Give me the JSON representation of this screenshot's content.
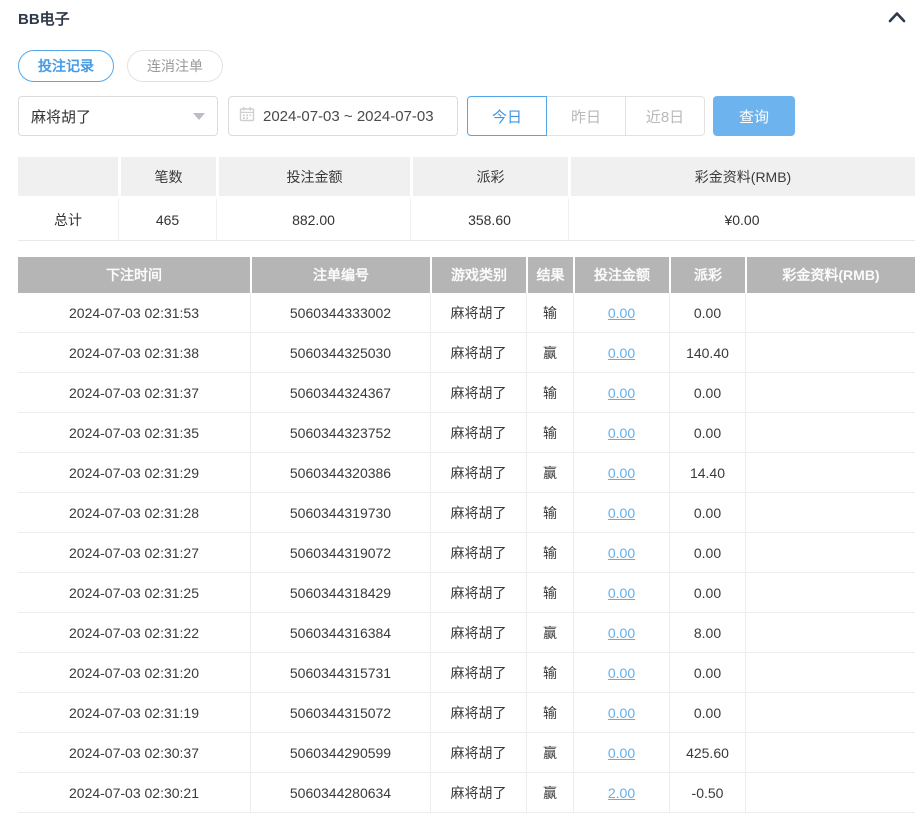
{
  "panel": {
    "title": "BB电子",
    "collapse_icon": "chevron-up-icon"
  },
  "tabs": [
    {
      "name": "tab-bet-records",
      "label": "投注记录",
      "active": true
    },
    {
      "name": "tab-cancelled-orders",
      "label": "连消注单",
      "active": false
    }
  ],
  "filters": {
    "game_select": {
      "value": "麻将胡了"
    },
    "date_range": {
      "value": "2024-07-03 ~ 2024-07-03"
    },
    "quick_buttons": [
      {
        "name": "today-button",
        "label": "今日",
        "active": true
      },
      {
        "name": "yesterday-button",
        "label": "昨日",
        "active": false
      },
      {
        "name": "last-8-days-button",
        "label": "近8日",
        "active": false
      }
    ],
    "search_label": "查询"
  },
  "summary": {
    "headers": [
      "",
      "笔数",
      "投注金额",
      "派彩",
      "彩金资料(RMB)"
    ],
    "row_label": "总计",
    "count": "465",
    "bet_amount": "882.00",
    "payout": "358.60",
    "bonus": "¥0.00"
  },
  "records_table": {
    "headers": [
      "下注时间",
      "注单编号",
      "游戏类别",
      "结果",
      "投注金额",
      "派彩",
      "彩金资料(RMB)"
    ],
    "rows": [
      {
        "time": "2024-07-03 02:31:53",
        "order_id": "5060344333002",
        "game": "麻将胡了",
        "result": "输",
        "bet": "0.00",
        "payout": "0.00",
        "bonus": ""
      },
      {
        "time": "2024-07-03 02:31:38",
        "order_id": "5060344325030",
        "game": "麻将胡了",
        "result": "赢",
        "bet": "0.00",
        "payout": "140.40",
        "bonus": ""
      },
      {
        "time": "2024-07-03 02:31:37",
        "order_id": "5060344324367",
        "game": "麻将胡了",
        "result": "输",
        "bet": "0.00",
        "payout": "0.00",
        "bonus": ""
      },
      {
        "time": "2024-07-03 02:31:35",
        "order_id": "5060344323752",
        "game": "麻将胡了",
        "result": "输",
        "bet": "0.00",
        "payout": "0.00",
        "bonus": ""
      },
      {
        "time": "2024-07-03 02:31:29",
        "order_id": "5060344320386",
        "game": "麻将胡了",
        "result": "赢",
        "bet": "0.00",
        "payout": "14.40",
        "bonus": ""
      },
      {
        "time": "2024-07-03 02:31:28",
        "order_id": "5060344319730",
        "game": "麻将胡了",
        "result": "输",
        "bet": "0.00",
        "payout": "0.00",
        "bonus": ""
      },
      {
        "time": "2024-07-03 02:31:27",
        "order_id": "5060344319072",
        "game": "麻将胡了",
        "result": "输",
        "bet": "0.00",
        "payout": "0.00",
        "bonus": ""
      },
      {
        "time": "2024-07-03 02:31:25",
        "order_id": "5060344318429",
        "game": "麻将胡了",
        "result": "输",
        "bet": "0.00",
        "payout": "0.00",
        "bonus": ""
      },
      {
        "time": "2024-07-03 02:31:22",
        "order_id": "5060344316384",
        "game": "麻将胡了",
        "result": "赢",
        "bet": "0.00",
        "payout": "8.00",
        "bonus": ""
      },
      {
        "time": "2024-07-03 02:31:20",
        "order_id": "5060344315731",
        "game": "麻将胡了",
        "result": "输",
        "bet": "0.00",
        "payout": "0.00",
        "bonus": ""
      },
      {
        "time": "2024-07-03 02:31:19",
        "order_id": "5060344315072",
        "game": "麻将胡了",
        "result": "输",
        "bet": "0.00",
        "payout": "0.00",
        "bonus": ""
      },
      {
        "time": "2024-07-03 02:30:37",
        "order_id": "5060344290599",
        "game": "麻将胡了",
        "result": "赢",
        "bet": "0.00",
        "payout": "425.60",
        "bonus": ""
      },
      {
        "time": "2024-07-03 02:30:21",
        "order_id": "5060344280634",
        "game": "麻将胡了",
        "result": "赢",
        "bet": "2.00",
        "payout": "-0.50",
        "bonus": ""
      }
    ]
  },
  "colors": {
    "accent_blue": "#54a8e9",
    "search_button_blue": "#6db3ed",
    "link_blue": "#5fb0ee",
    "negative_red": "#f35d5d",
    "table_header_gray": "#b5b5b5"
  }
}
